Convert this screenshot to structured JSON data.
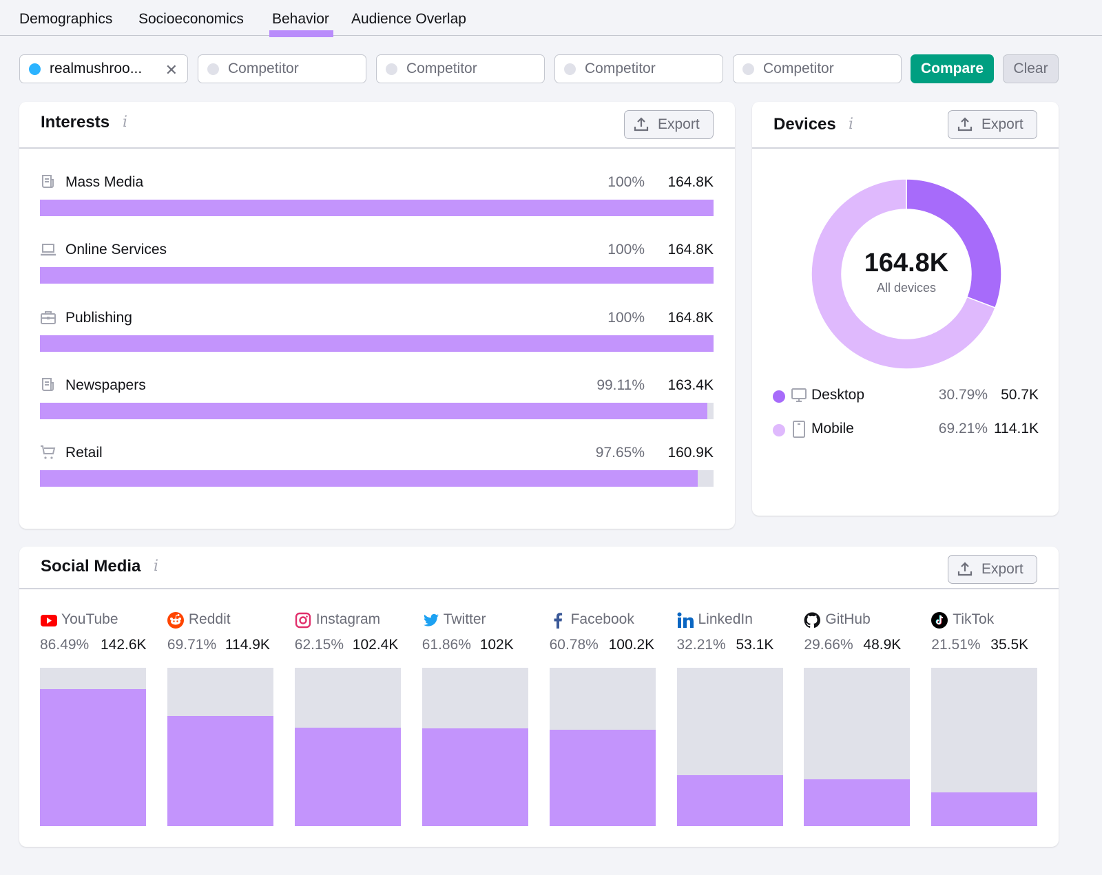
{
  "tabs": [
    {
      "label": "Demographics",
      "active": false
    },
    {
      "label": "Socioeconomics",
      "active": false
    },
    {
      "label": "Behavior",
      "active": true
    },
    {
      "label": "Audience Overlap",
      "active": false
    }
  ],
  "compare_bar": {
    "primary_domain": "realmushroo...",
    "primary_color": "#2bb3ff",
    "competitor_placeholder": "Competitor",
    "competitor_dot_color": "#e0e1e9",
    "compare_label": "Compare",
    "clear_label": "Clear"
  },
  "colors": {
    "accent": "#c394fc",
    "accent_dark": "#a76bfa",
    "accent_light": "#dfb9fd",
    "track": "#e0e1e9",
    "compare_button": "#009f81"
  },
  "interests": {
    "title": "Interests",
    "info_icon": "i",
    "export_label": "Export",
    "items": [
      {
        "icon": "newspaper-icon",
        "name": "Mass Media",
        "pct_label": "100%",
        "count": "164.8K",
        "share": 100
      },
      {
        "icon": "laptop-icon",
        "name": "Online Services",
        "pct_label": "100%",
        "count": "164.8K",
        "share": 100
      },
      {
        "icon": "briefcase-icon",
        "name": "Publishing",
        "pct_label": "100%",
        "count": "164.8K",
        "share": 100
      },
      {
        "icon": "newspaper-icon",
        "name": "Newspapers",
        "pct_label": "99.11%",
        "count": "163.4K",
        "share": 99.11
      },
      {
        "icon": "cart-icon",
        "name": "Retail",
        "pct_label": "97.65%",
        "count": "160.9K",
        "share": 97.65
      }
    ]
  },
  "devices": {
    "title": "Devices",
    "info_icon": "i",
    "export_label": "Export",
    "total": "164.8K",
    "total_label": "All devices",
    "items": [
      {
        "icon": "desktop-icon",
        "name": "Desktop",
        "pct_label": "30.79%",
        "count": "50.7K",
        "share": 30.79,
        "color": "#a76bfa"
      },
      {
        "icon": "mobile-icon",
        "name": "Mobile",
        "pct_label": "69.21%",
        "count": "114.1K",
        "share": 69.21,
        "color": "#dfb9fd"
      }
    ]
  },
  "social_media": {
    "title": "Social Media",
    "info_icon": "i",
    "export_label": "Export",
    "items": [
      {
        "logo": "youtube-icon",
        "name": "YouTube",
        "pct_label": "86.49%",
        "count": "142.6K",
        "share": 86.49
      },
      {
        "logo": "reddit-icon",
        "name": "Reddit",
        "pct_label": "69.71%",
        "count": "114.9K",
        "share": 69.71
      },
      {
        "logo": "instagram-icon",
        "name": "Instagram",
        "pct_label": "62.15%",
        "count": "102.4K",
        "share": 62.15
      },
      {
        "logo": "twitter-icon",
        "name": "Twitter",
        "pct_label": "61.86%",
        "count": "102K",
        "share": 61.86
      },
      {
        "logo": "facebook-icon",
        "name": "Facebook",
        "pct_label": "60.78%",
        "count": "100.2K",
        "share": 60.78
      },
      {
        "logo": "linkedin-icon",
        "name": "LinkedIn",
        "pct_label": "32.21%",
        "count": "53.1K",
        "share": 32.21
      },
      {
        "logo": "github-icon",
        "name": "GitHub",
        "pct_label": "29.66%",
        "count": "48.9K",
        "share": 29.66
      },
      {
        "logo": "tiktok-icon",
        "name": "TikTok",
        "pct_label": "21.51%",
        "count": "35.5K",
        "share": 21.51
      }
    ]
  }
}
